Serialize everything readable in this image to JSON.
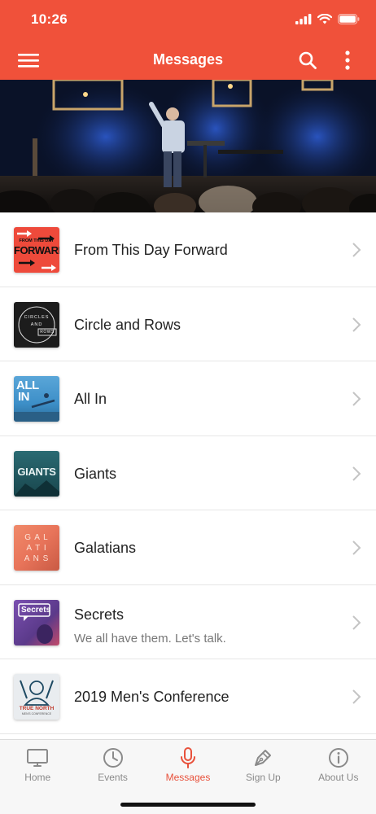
{
  "status_bar": {
    "time": "10:26"
  },
  "nav": {
    "title": "Messages"
  },
  "list": [
    {
      "title": "From This Day Forward",
      "subtitle": "",
      "thumb": {
        "line1": "FROM THIS DAY",
        "line2": "FORWARD",
        "bg": "#ee4a3b"
      }
    },
    {
      "title": "Circle and Rows",
      "subtitle": "",
      "thumb": {
        "line1": "CIRCLES",
        "line2": "AND",
        "line3": "ROWS",
        "bg": "#1c1c1c"
      }
    },
    {
      "title": "All In",
      "subtitle": "",
      "thumb": {
        "line1": "ALL",
        "line2": "IN",
        "bg": "#3d8fc8"
      }
    },
    {
      "title": "Giants",
      "subtitle": "",
      "thumb": {
        "line1": "GIANTS",
        "bg": "#19464d"
      }
    },
    {
      "title": "Galatians",
      "subtitle": "",
      "thumb": {
        "line1": "G A L",
        "line2": "A T I",
        "line3": "A N S",
        "bg": "#e8745a"
      }
    },
    {
      "title": "Secrets",
      "subtitle": "We all have them. Let's talk.",
      "thumb": {
        "line1": "Secrets",
        "bg": "#5b3a8a"
      }
    },
    {
      "title": "2019 Men's Conference",
      "subtitle": "",
      "thumb": {
        "line1": "TRUE NORTH",
        "line2": "MEN'S CONFERENCE",
        "bg": "#e9ecef"
      }
    }
  ],
  "tabs": [
    {
      "label": "Home",
      "icon": "monitor-icon",
      "active": false
    },
    {
      "label": "Events",
      "icon": "clock-icon",
      "active": false
    },
    {
      "label": "Messages",
      "icon": "microphone-icon",
      "active": true
    },
    {
      "label": "Sign Up",
      "icon": "pen-icon",
      "active": false
    },
    {
      "label": "About Us",
      "icon": "info-icon",
      "active": false
    }
  ],
  "colors": {
    "brand": "#f0513a",
    "tab_active": "#e8513b",
    "tab_inactive": "#8a8a8a"
  }
}
